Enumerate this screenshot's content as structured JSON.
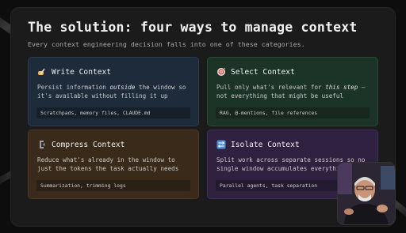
{
  "slide": {
    "title": "The solution: four ways to manage context",
    "subtitle": "Every context engineering decision falls into one of these categories."
  },
  "cards": [
    {
      "title": "Write Context",
      "icon": "writing-hand-icon",
      "desc_pre": "Persist information ",
      "desc_em": "outside",
      "desc_post": " the window so it's available without filling it up",
      "tag": "Scratchpads, memory files, CLAUDE.md",
      "color": "#1d2b3a"
    },
    {
      "title": "Select Context",
      "icon": "target-icon",
      "desc_pre": "Pull only what's relevant for ",
      "desc_em": "this step",
      "desc_post": " — not everything that might be useful",
      "tag": "RAG, @-mentions, file references",
      "color": "#1c3427"
    },
    {
      "title": "Compress Context",
      "icon": "clamp-icon",
      "desc_pre": "Reduce what's already in the window to just the tokens the task actually needs",
      "desc_em": "",
      "desc_post": "",
      "tag": "Summarization, trimming logs",
      "color": "#3a2a19"
    },
    {
      "title": "Isolate Context",
      "icon": "split-icon",
      "desc_pre": "Split work across separate sessions so no single window accumulates everything",
      "desc_em": "",
      "desc_post": "",
      "tag": "Parallel agents, task separation",
      "color": "#2f2140"
    }
  ]
}
